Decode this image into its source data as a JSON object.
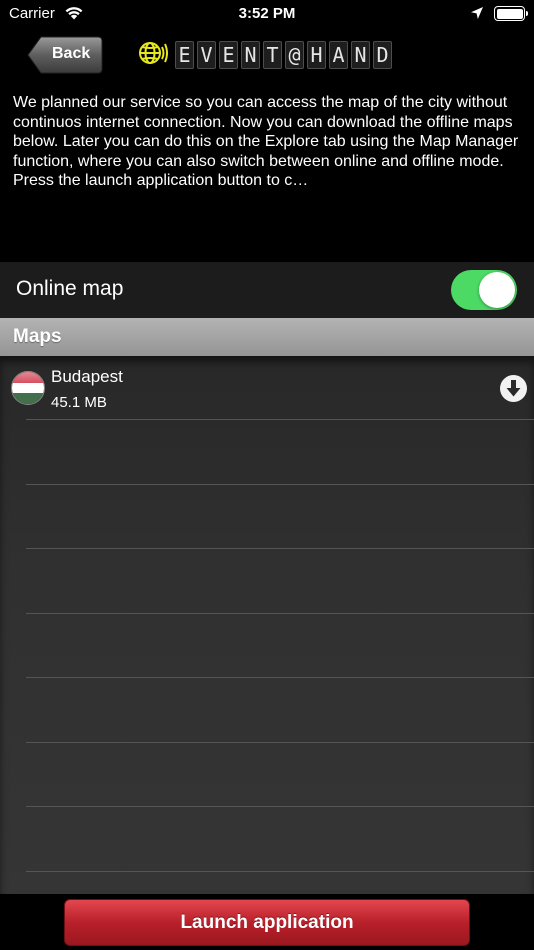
{
  "status_bar": {
    "carrier": "Carrier",
    "time": "3:52 PM",
    "icons": [
      "wifi-icon",
      "location-arrow-icon",
      "battery-icon"
    ]
  },
  "nav": {
    "back_label": "Back",
    "logo_text": "EVENT@HAND",
    "logo_icon": "globe-signal-icon",
    "logo_color": "#e8e81e"
  },
  "intro": {
    "text": "We planned our service so you can access the map of the city without continuos internet connection. Now you can download the offline maps below. Later you can do this on the Explore tab using the Map Manager function, where you can also switch between online and offline mode. Press the launch application button to c…"
  },
  "online_map": {
    "label": "Online map",
    "enabled": true,
    "toggle_color": "#4cd964"
  },
  "maps_section": {
    "title": "Maps",
    "items": [
      {
        "name": "Budapest",
        "size": "45.1 MB",
        "flag": "hungary-flag-icon",
        "action_icon": "download-icon"
      }
    ],
    "empty_rows": 7
  },
  "launch": {
    "label": "Launch application",
    "color": "#c1272d"
  }
}
